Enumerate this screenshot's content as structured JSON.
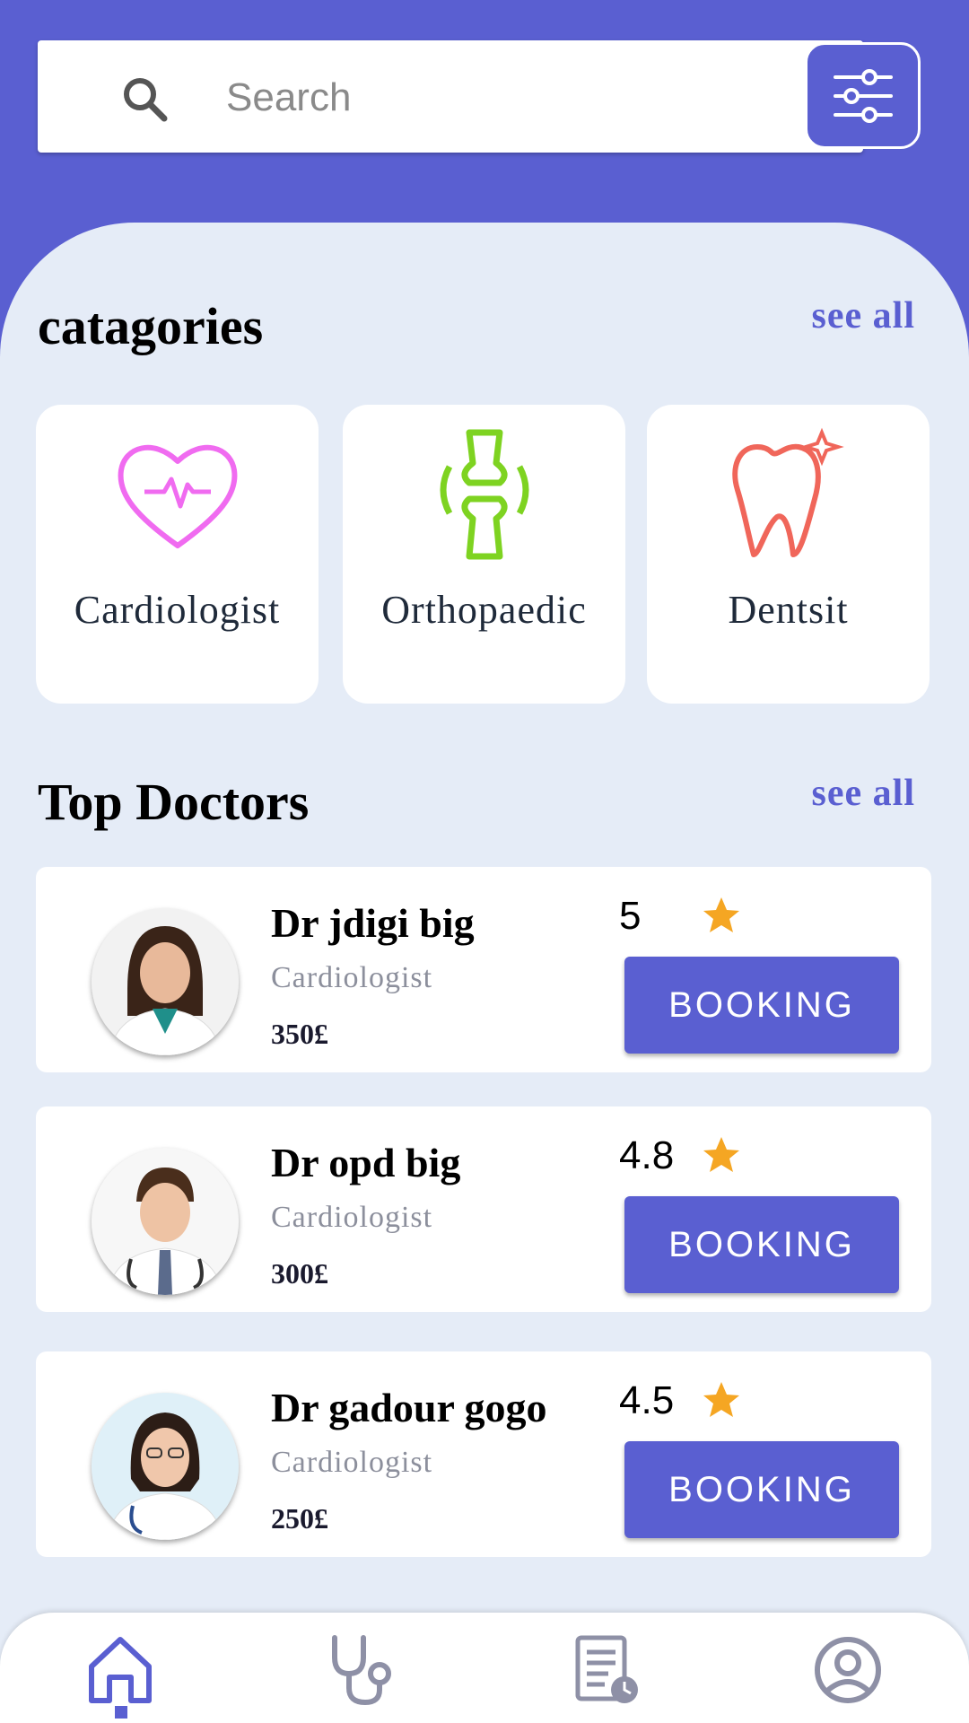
{
  "search": {
    "placeholder": "Search"
  },
  "categories_section": {
    "title": "catagories",
    "see_all": "see all",
    "items": [
      {
        "label": "Cardiologist",
        "icon": "heart-pulse-icon",
        "color": "#f06bf0"
      },
      {
        "label": "Orthopaedic",
        "icon": "bone-joint-icon",
        "color": "#7ed321"
      },
      {
        "label": "Dentsit",
        "icon": "tooth-icon",
        "color": "#f0665a"
      }
    ]
  },
  "top_doctors": {
    "title": "Top Doctors",
    "see_all": "see all",
    "doctors": [
      {
        "name": "Dr jdigi big",
        "specialty": "Cardiologist",
        "price": "350£",
        "rating": "5",
        "button": "BOOKING"
      },
      {
        "name": "Dr opd big",
        "specialty": "Cardiologist",
        "price": "300£",
        "rating": "4.8",
        "button": "BOOKING"
      },
      {
        "name": "Dr gadour gogo",
        "specialty": "Cardiologist",
        "price": "250£",
        "rating": "4.5",
        "button": "BOOKING"
      }
    ]
  },
  "bottom_nav": {
    "items": [
      {
        "icon": "home-icon",
        "active": true
      },
      {
        "icon": "stethoscope-icon",
        "active": false
      },
      {
        "icon": "records-clock-icon",
        "active": false
      },
      {
        "icon": "profile-icon",
        "active": false
      }
    ]
  },
  "colors": {
    "primary": "#5a5fd1",
    "background": "#e5ecf7",
    "star": "#f5a623",
    "nav_inactive": "#8e90a6"
  }
}
